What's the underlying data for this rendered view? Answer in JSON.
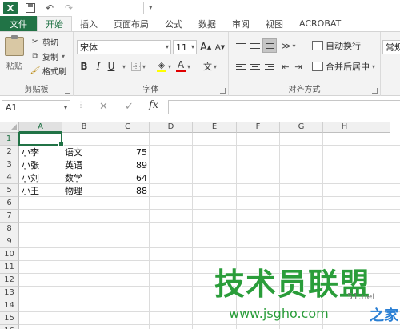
{
  "app": {
    "logo": "X"
  },
  "tabs": [
    "文件",
    "开始",
    "插入",
    "页面布局",
    "公式",
    "数据",
    "审阅",
    "视图",
    "ACROBAT"
  ],
  "ribbon": {
    "clipboard": {
      "paste": "粘贴",
      "cut": "剪切",
      "copy": "复制",
      "format_painter": "格式刷",
      "group_label": "剪贴板"
    },
    "font": {
      "font_name": "宋体",
      "font_size": "11",
      "bold": "B",
      "italic": "I",
      "underline": "U",
      "grow": "A",
      "shrink": "A",
      "font_color_letter": "A",
      "phonetic": "文",
      "group_label": "字体"
    },
    "alignment": {
      "wrap_text": "自动换行",
      "merge_center": "合并后居中",
      "group_label": "对齐方式"
    },
    "number": {
      "format": "常规"
    }
  },
  "formula_bar": {
    "name_box": "A1",
    "fx": "fx",
    "cancel": "✕",
    "enter": "✓"
  },
  "grid": {
    "columns": [
      "A",
      "B",
      "C",
      "D",
      "E",
      "F",
      "G",
      "H",
      "I"
    ],
    "rows": [
      "1",
      "2",
      "3",
      "4",
      "5",
      "6",
      "7",
      "8",
      "9",
      "10",
      "11",
      "12",
      "13",
      "14",
      "15",
      "16"
    ],
    "data": [
      [
        "小李",
        "语文",
        "75"
      ],
      [
        "小张",
        "英语",
        "89"
      ],
      [
        "小刘",
        "数学",
        "64"
      ],
      [
        "小王",
        "物理",
        "88"
      ]
    ]
  },
  "watermark": {
    "title": "技术员联盟",
    "url": "www.jsgho.com",
    "side_text": "51.net",
    "home": "之家"
  },
  "colors": {
    "accent": "#217346",
    "watermark_green": "#2a9d3a"
  }
}
